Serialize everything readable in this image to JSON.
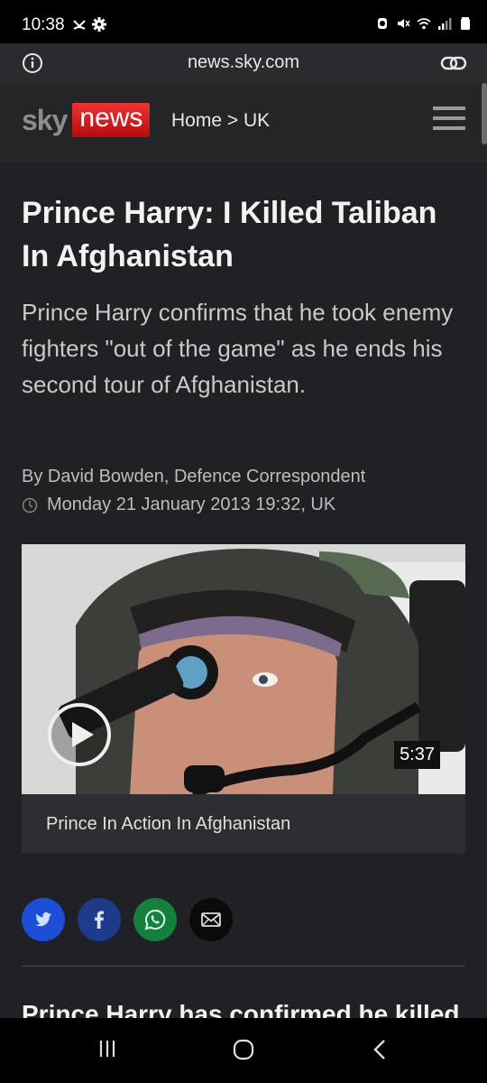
{
  "status_bar": {
    "time": "10:38",
    "left_icons": [
      "missed-call-icon",
      "gear-icon"
    ],
    "right_icons": [
      "alarm-icon",
      "mute-icon",
      "wifi-icon",
      "signal-icon",
      "battery-icon"
    ]
  },
  "browser": {
    "url": "news.sky.com",
    "left_icon": "info-icon",
    "right_icon": "link-icon"
  },
  "site_header": {
    "logo_sky": "sky",
    "logo_news": "news",
    "breadcrumb": "Home > UK",
    "menu_icon": "hamburger-menu-icon",
    "brand_red": "#d91a1a"
  },
  "article": {
    "headline": "Prince Harry: I Killed Taliban In Afghanistan",
    "standfirst": "Prince Harry confirms that he took enemy fighters \"out of the game\" as he ends his second tour of Afghanistan.",
    "byline": "By David Bowden, Defence Correspondent",
    "date": "Monday 21 January 2013 19:32, UK"
  },
  "video": {
    "duration": "5:37",
    "caption": "Prince In Action In Afghanistan",
    "play_icon": "play-icon"
  },
  "share": {
    "buttons": [
      {
        "name": "twitter",
        "icon": "twitter-icon",
        "color": "#1d4ed8"
      },
      {
        "name": "facebook",
        "icon": "facebook-icon",
        "color": "#1e3a8a"
      },
      {
        "name": "whatsapp",
        "icon": "whatsapp-icon",
        "color": "#15803d"
      },
      {
        "name": "email",
        "icon": "email-icon",
        "color": "#0a0a0a"
      }
    ]
  },
  "body_teaser": "Prince Harry has confirmed he killed",
  "nav_bar": {
    "icons": [
      "recent-apps-icon",
      "home-icon",
      "back-icon"
    ]
  }
}
